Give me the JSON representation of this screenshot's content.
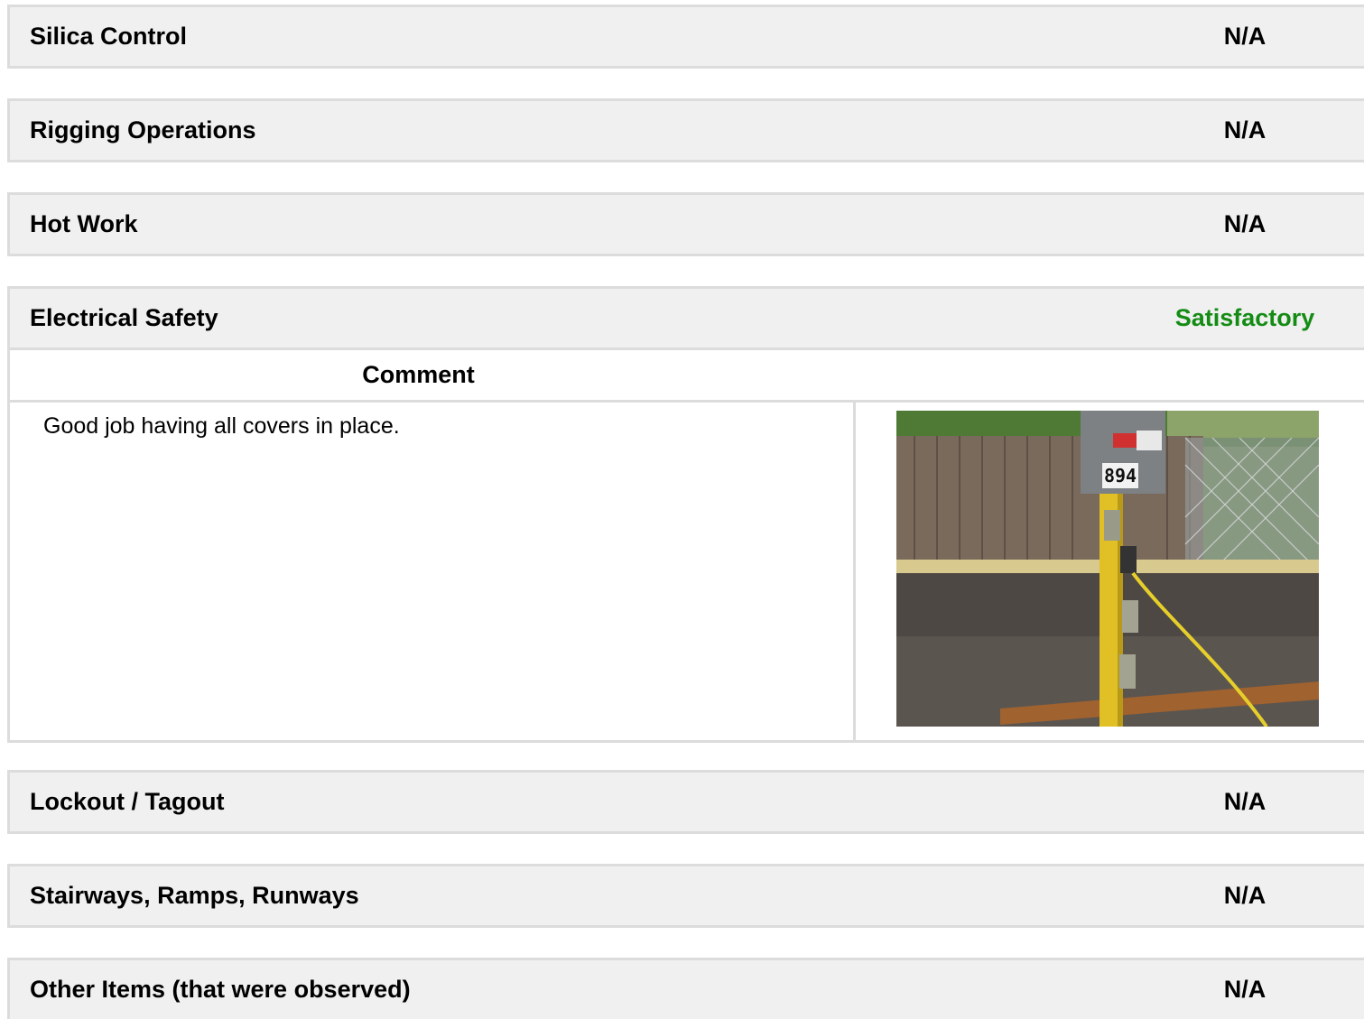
{
  "sections": [
    {
      "title": "Silica Control",
      "status": "N/A"
    },
    {
      "title": "Rigging Operations",
      "status": "N/A"
    },
    {
      "title": "Hot Work",
      "status": "N/A"
    },
    {
      "title": "Electrical Safety",
      "status": "Satisfactory",
      "status_color": "#148c14",
      "comment_header": "Comment",
      "comment_text": "Good job having all covers in place.",
      "photo_label": "894"
    },
    {
      "title": "Lockout / Tagout",
      "status": "N/A"
    },
    {
      "title": "Stairways, Ramps, Runways",
      "status": "N/A"
    },
    {
      "title": "Other Items (that were observed)",
      "status": "N/A"
    }
  ]
}
